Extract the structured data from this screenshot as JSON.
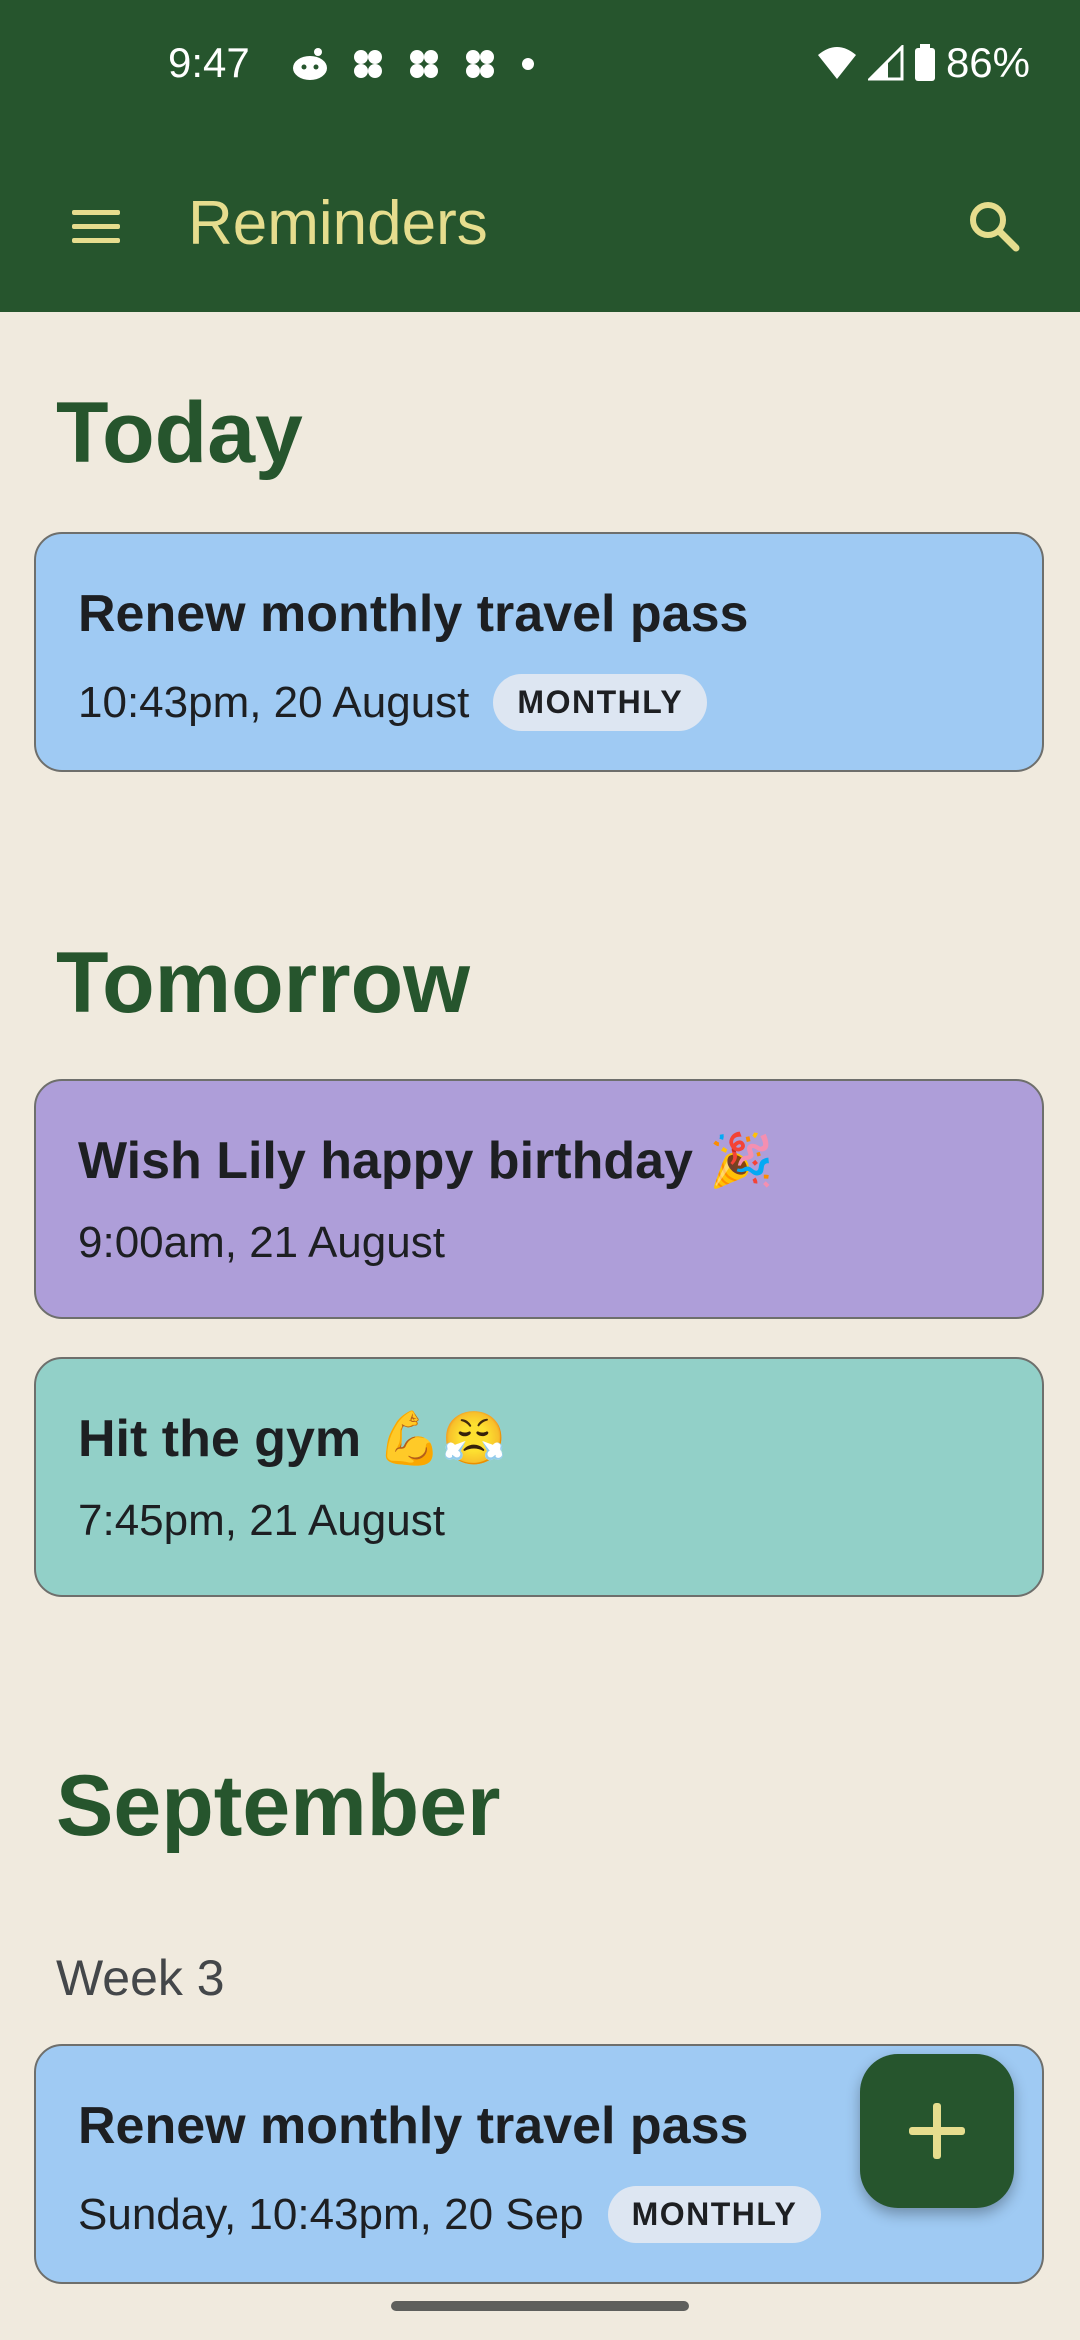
{
  "status_bar": {
    "time": "9:47",
    "battery": "86%",
    "notification_icons": [
      "reddit-icon",
      "app-icon",
      "app-icon",
      "app-icon",
      "dot-icon"
    ]
  },
  "app_bar": {
    "title": "Reminders",
    "menu_icon": "menu-icon",
    "search_icon": "search-icon",
    "color": "#26552D",
    "title_color": "#E6DD8E"
  },
  "sections": {
    "today": {
      "title": "Today",
      "items": [
        {
          "title": "Renew monthly travel pass",
          "time": "10:43pm, 20 August",
          "badge": "MONTHLY",
          "color": "#9FCAF3"
        }
      ]
    },
    "tomorrow": {
      "title": "Tomorrow",
      "items": [
        {
          "title": "Wish Lily happy birthday",
          "emoji": "🎉",
          "time": "9:00am, 21 August",
          "color": "#AE9ED9"
        },
        {
          "title": "Hit the gym",
          "emoji": "💪😤",
          "time": "7:45pm, 21 August",
          "color": "#92D0C8"
        }
      ]
    },
    "september": {
      "title": "September",
      "week_label": "Week 3",
      "items": [
        {
          "title": "Renew monthly travel pass",
          "time": "Sunday, 10:43pm, 20 Sep",
          "badge": "MONTHLY",
          "color": "#9FCAF3"
        }
      ]
    }
  },
  "fab": {
    "icon": "plus-icon"
  }
}
